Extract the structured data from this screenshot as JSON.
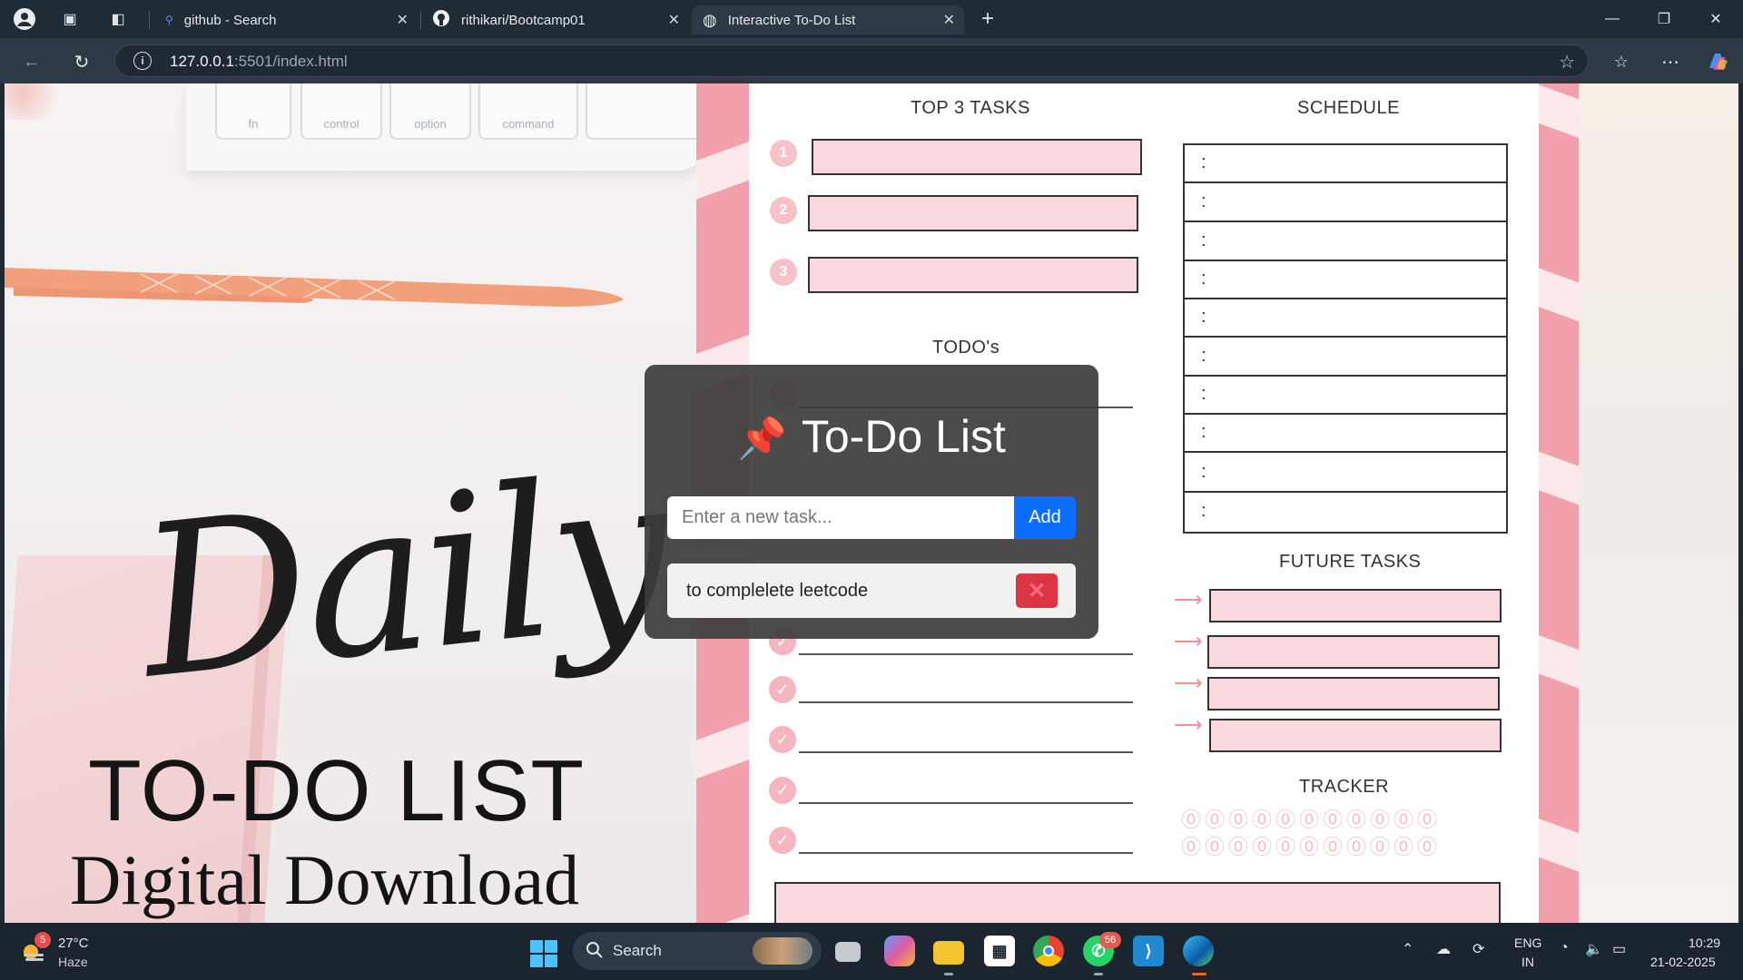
{
  "browser": {
    "tabs": [
      {
        "title": "github - Search",
        "icon": "search-icon",
        "active": false
      },
      {
        "title": "rithikari/Bootcamp01",
        "icon": "github-icon",
        "active": false
      },
      {
        "title": "Interactive To-Do List",
        "icon": "globe-icon",
        "active": true
      }
    ],
    "url_host": "127.0.0.1",
    "url_rest": ":5501/index.html"
  },
  "background_text": {
    "script": "Daily",
    "headline": "TO-DO LIST",
    "subline": "Digital Download",
    "keys": [
      "fn",
      "control",
      "option",
      "command"
    ]
  },
  "planner": {
    "top3_heading": "TOP 3 TASKS",
    "schedule_heading": "SCHEDULE",
    "todos_heading": "TODO's",
    "future_heading": "FUTURE TASKS",
    "tracker_heading": "TRACKER",
    "schedule_slots": [
      ":",
      ":",
      ":",
      ":",
      ":",
      ":",
      ":",
      ":",
      ":",
      ":"
    ]
  },
  "todo_app": {
    "title": "To-Do List",
    "input_placeholder": "Enter a new task...",
    "add_label": "Add",
    "tasks": [
      "to complelete leetcode"
    ],
    "delete_glyph": "✕"
  },
  "taskbar": {
    "weather_temp": "27°C",
    "weather_condition": "Haze",
    "weather_badge": "5",
    "search_label": "Search",
    "whatsapp_badge": "56",
    "lang_line1": "ENG",
    "lang_line2": "IN",
    "time": "10:29",
    "date": "21-02-2025"
  }
}
